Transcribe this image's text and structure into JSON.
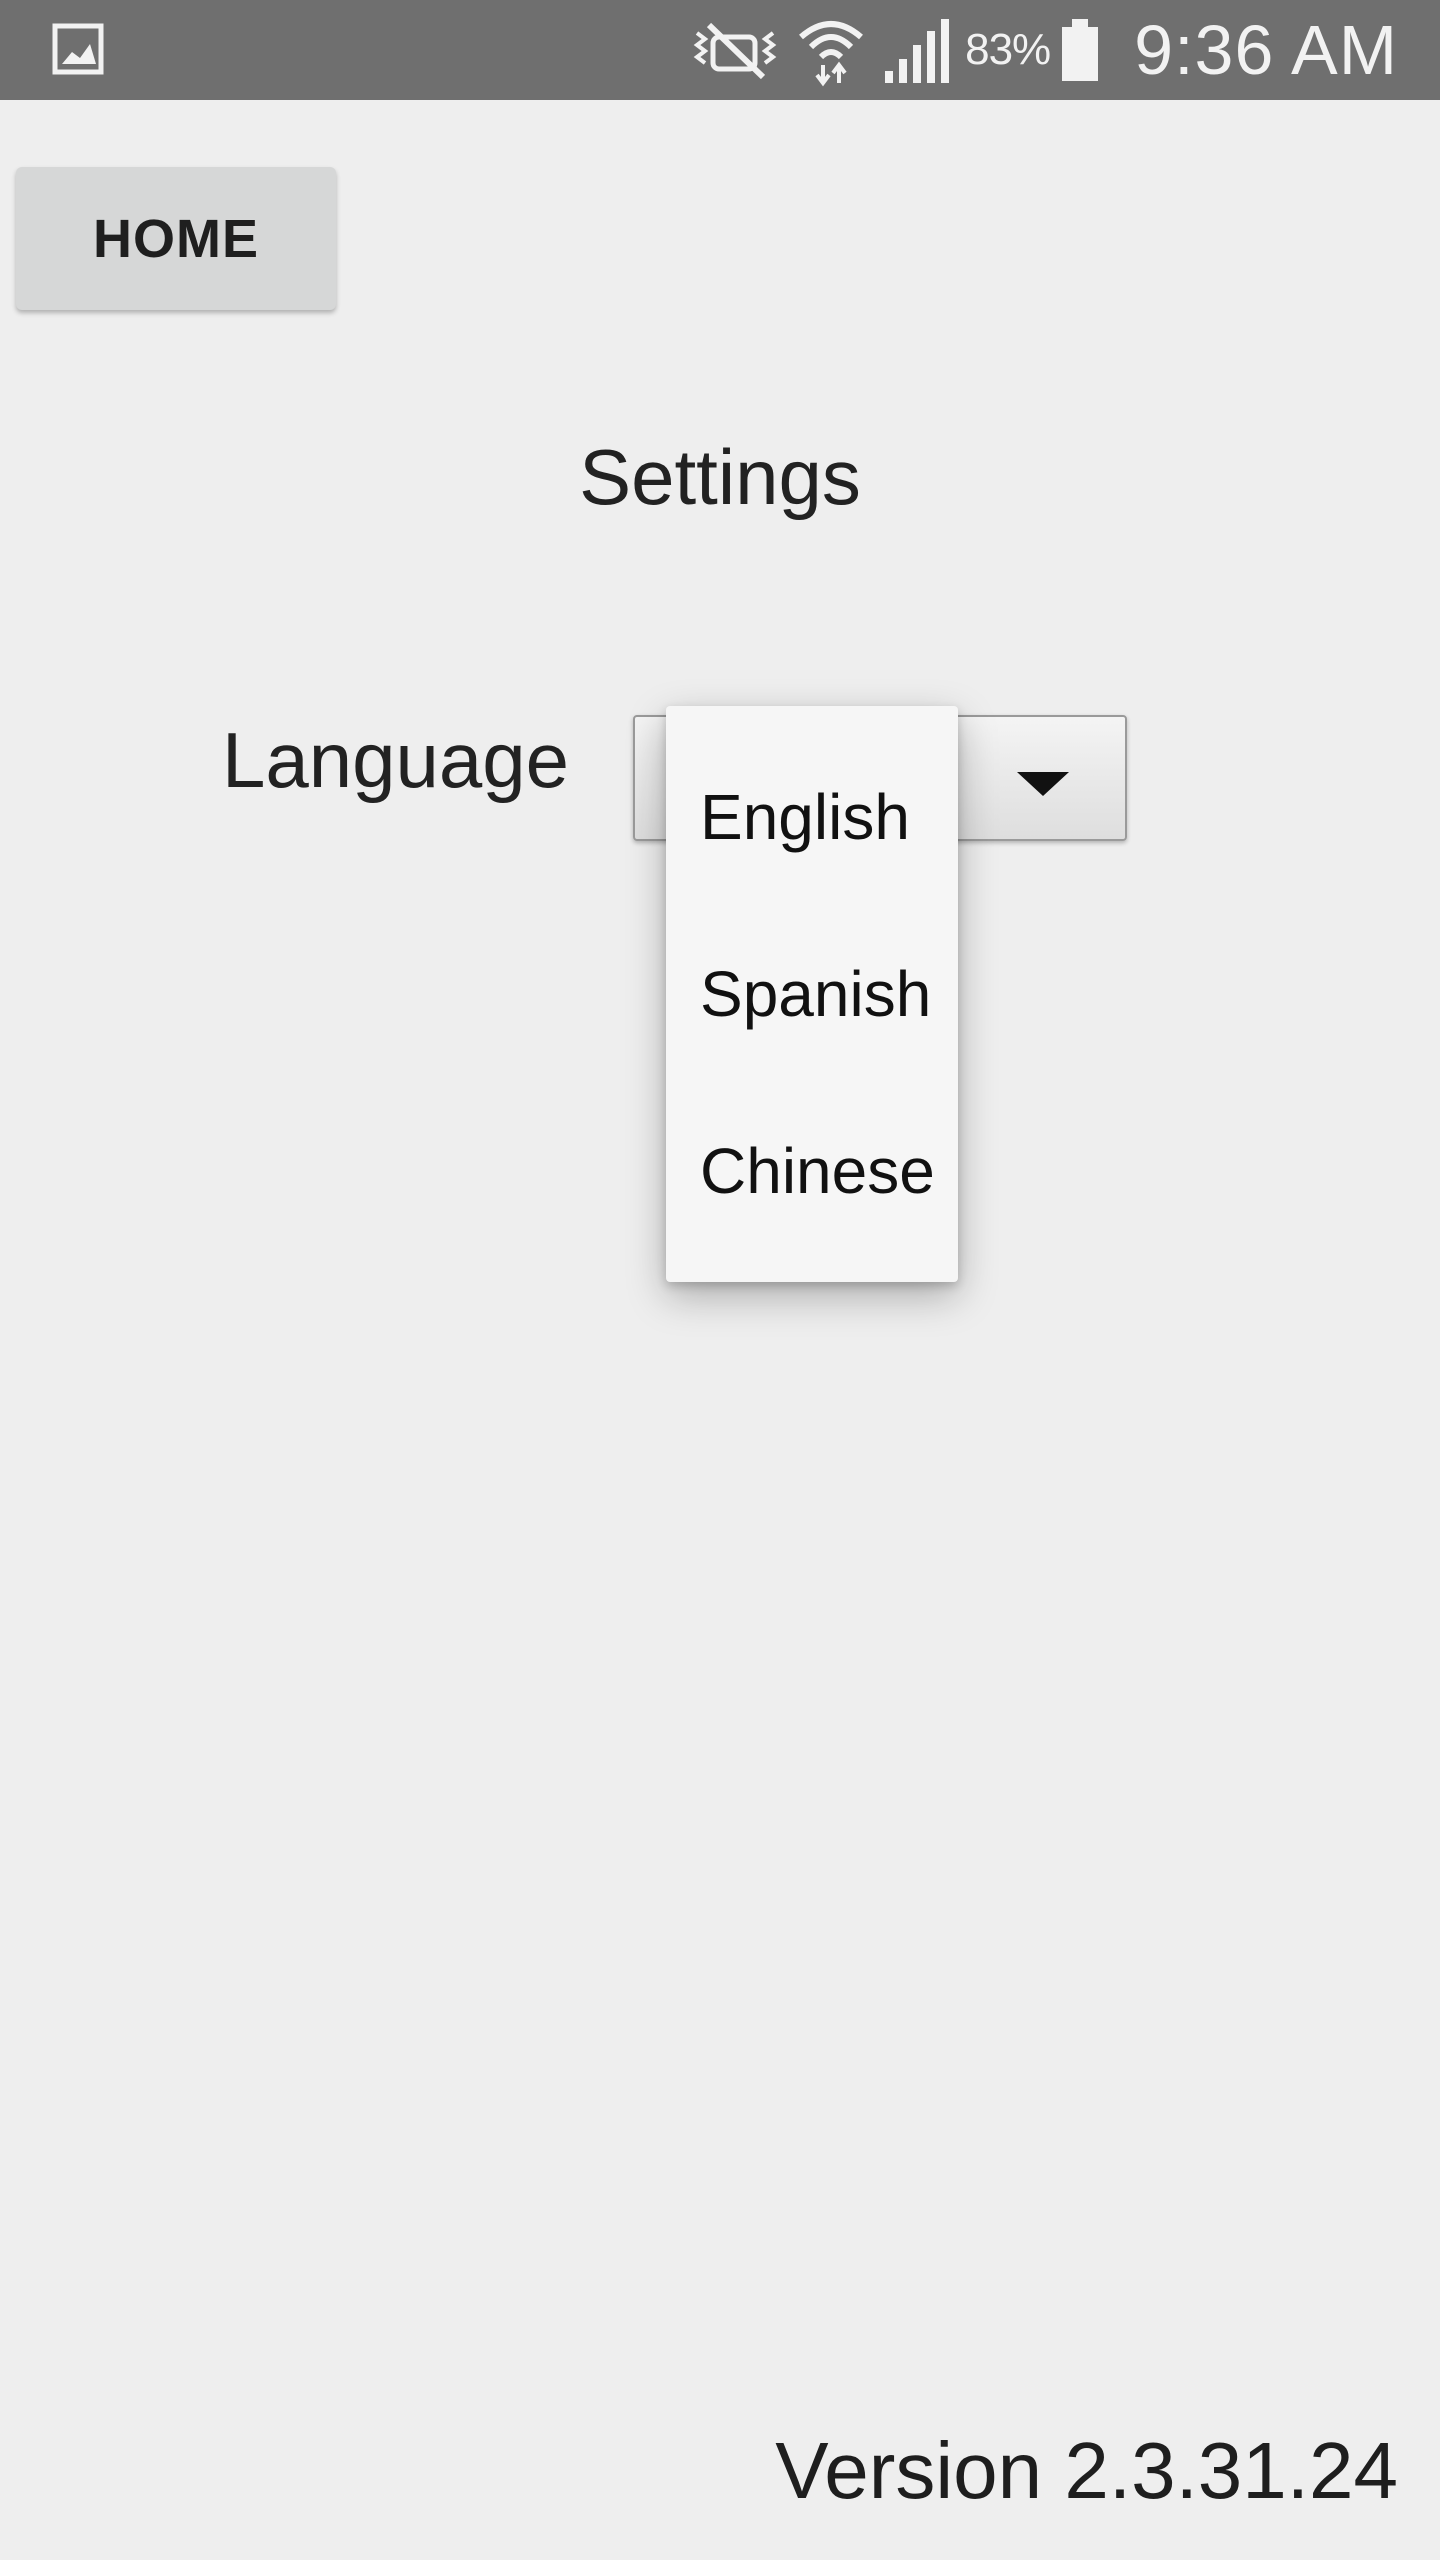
{
  "status_bar": {
    "battery_percent": "83%",
    "time": "9:36 AM",
    "icons": [
      "image-notification-icon",
      "mute-vibrate-icon",
      "wifi-icon",
      "signal-icon",
      "battery-icon"
    ]
  },
  "home_button": {
    "label": "HOME"
  },
  "page": {
    "title": "Settings",
    "language_label": "Language"
  },
  "language_dropdown": {
    "options": [
      "English",
      "Spanish",
      "Chinese"
    ]
  },
  "footer": {
    "version": "Version 2.3.31.24"
  },
  "colors": {
    "status_bar": "#6f6f6f",
    "background": "#eeeeee",
    "button": "#d6d7d7",
    "dropdown": "#f6f6f6"
  }
}
